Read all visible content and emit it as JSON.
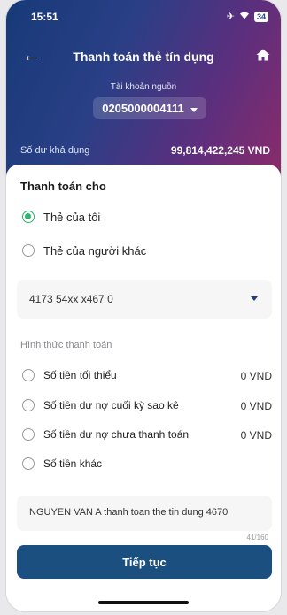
{
  "status_bar": {
    "time": "15:51",
    "battery": "34"
  },
  "header": {
    "title": "Thanh toán thẻ tín dụng",
    "source_label": "Tài khoản nguồn",
    "source_account": "0205000004111",
    "balance_label": "Số dư khả dụng",
    "balance_value": "99,814,422,245 VND"
  },
  "form": {
    "section_title": "Thanh toán cho",
    "recipient_options": [
      {
        "label": "Thẻ của tôi",
        "selected": true
      },
      {
        "label": "Thẻ của người khác",
        "selected": false
      }
    ],
    "card_number": "4173 54xx x467 0",
    "payment_method_label": "Hình thức thanh toán",
    "payment_options": [
      {
        "label": "Số tiền tối thiểu",
        "amount": "0 VND"
      },
      {
        "label": "Số tiền dư nợ cuối kỳ sao kê",
        "amount": "0 VND"
      },
      {
        "label": "Số tiền dư nợ chưa thanh toán",
        "amount": "0 VND"
      },
      {
        "label": "Số tiền khác",
        "amount": ""
      }
    ],
    "description": "NGUYEN VAN A  thanh toan the tin dung 4670",
    "char_counter": "41/160",
    "continue_label": "Tiếp tục"
  },
  "colors": {
    "accent_green": "#2fb26d",
    "primary_button": "#1b4f80"
  }
}
